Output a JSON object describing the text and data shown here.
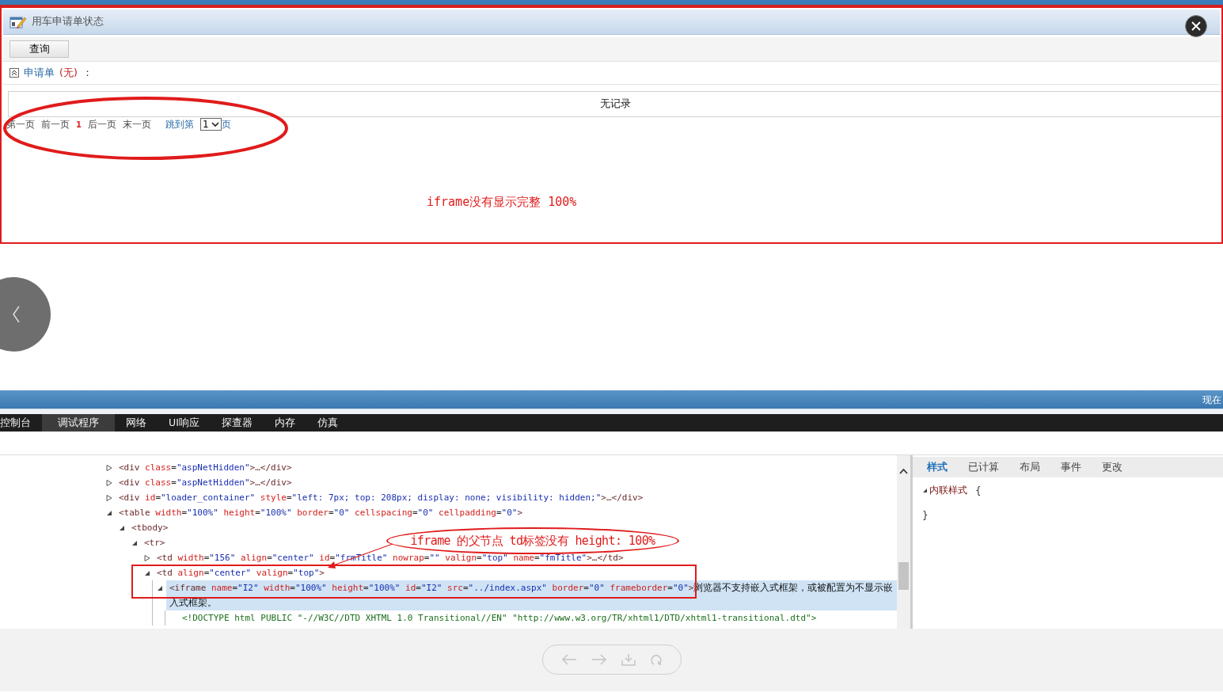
{
  "window": {
    "title": "用车申请单状态"
  },
  "toolbar": {
    "buttons": [
      "查询"
    ]
  },
  "section": {
    "label": "申请单",
    "count": "(无)",
    "colon": "：",
    "expanded": true
  },
  "table": {
    "empty_text": "无记录"
  },
  "pager": {
    "links_before": [
      "第一页",
      "前一页"
    ],
    "current": "1",
    "links_after": [
      "后一页",
      "末一页"
    ],
    "jump_prefix": "跳到第",
    "jump_value": "1",
    "jump_suffix": "页"
  },
  "annotations": [
    {
      "kind": "note",
      "text": "iframe没有显示完整 100%"
    },
    {
      "kind": "callout",
      "text": "iframe 的父节点 td标签没有 height: 100%"
    }
  ],
  "status_band": {
    "text": "现在"
  },
  "devtools": {
    "tabs": [
      {
        "label": "控制台",
        "selected": false
      },
      {
        "label": "调试程序",
        "selected": true
      },
      {
        "label": "网络",
        "selected": false
      },
      {
        "label": "UI响应",
        "selected": false
      },
      {
        "label": "探查器",
        "selected": false
      },
      {
        "label": "内存",
        "selected": false
      },
      {
        "label": "仿真",
        "selected": false
      }
    ],
    "dom_tree": [
      {
        "kind": "element",
        "expanded": false,
        "selected": false,
        "parts": [
          {
            "tag": "<div"
          },
          {
            "attr": " class"
          },
          {
            "eq": "="
          },
          {
            "val": "\"aspNetHidden\""
          },
          {
            "tag": ">…</div>"
          }
        ]
      },
      {
        "kind": "element",
        "expanded": false,
        "selected": false,
        "parts": [
          {
            "tag": "<div"
          },
          {
            "attr": " class"
          },
          {
            "eq": "="
          },
          {
            "val": "\"aspNetHidden\""
          },
          {
            "tag": ">…</div>"
          }
        ]
      },
      {
        "kind": "element",
        "expanded": false,
        "selected": false,
        "parts": [
          {
            "tag": "<div"
          },
          {
            "attr": " id"
          },
          {
            "eq": "="
          },
          {
            "val": "\"loader_container\""
          },
          {
            "attr": " style"
          },
          {
            "eq": "="
          },
          {
            "val": "\"left: 7px; top: 208px; display: none; visibility: hidden;\""
          },
          {
            "tag": ">…</div>"
          }
        ]
      },
      {
        "kind": "element",
        "expanded": true,
        "selected": false,
        "parts": [
          {
            "tag": "<table"
          },
          {
            "attr": " width"
          },
          {
            "eq": "="
          },
          {
            "val": "\"100%\""
          },
          {
            "attr": " height"
          },
          {
            "eq": "="
          },
          {
            "val": "\"100%\""
          },
          {
            "attr": " border"
          },
          {
            "eq": "="
          },
          {
            "val": "\"0\""
          },
          {
            "attr": " cellspacing"
          },
          {
            "eq": "="
          },
          {
            "val": "\"0\""
          },
          {
            "attr": " cellpadding"
          },
          {
            "eq": "="
          },
          {
            "val": "\"0\""
          },
          {
            "tag": ">"
          }
        ],
        "children": [
          {
            "kind": "element",
            "expanded": true,
            "selected": false,
            "parts": [
              {
                "tag": "<tbody>"
              }
            ],
            "children": [
              {
                "kind": "element",
                "expanded": true,
                "selected": false,
                "parts": [
                  {
                    "tag": "<tr>"
                  }
                ],
                "children": [
                  {
                    "kind": "element",
                    "expanded": false,
                    "selected": false,
                    "parts": [
                      {
                        "tag": "<td"
                      },
                      {
                        "attr": " width"
                      },
                      {
                        "eq": "="
                      },
                      {
                        "val": "\"156\""
                      },
                      {
                        "attr": " align"
                      },
                      {
                        "eq": "="
                      },
                      {
                        "val": "\"center\""
                      },
                      {
                        "attr": " id"
                      },
                      {
                        "eq": "="
                      },
                      {
                        "val": "\"frmTitle\""
                      },
                      {
                        "attr": " nowrap"
                      },
                      {
                        "eq": "="
                      },
                      {
                        "val": "\"\""
                      },
                      {
                        "attr": " valign"
                      },
                      {
                        "eq": "="
                      },
                      {
                        "val": "\"top\""
                      },
                      {
                        "attr": " name"
                      },
                      {
                        "eq": "="
                      },
                      {
                        "val": "\"fmTitle\""
                      },
                      {
                        "tag": ">…</td>"
                      }
                    ]
                  },
                  {
                    "kind": "element",
                    "expanded": true,
                    "selected": false,
                    "parts": [
                      {
                        "tag": "<td"
                      },
                      {
                        "attr": " align"
                      },
                      {
                        "eq": "="
                      },
                      {
                        "val": "\"center\""
                      },
                      {
                        "attr": " valign"
                      },
                      {
                        "eq": "="
                      },
                      {
                        "val": "\"top\""
                      },
                      {
                        "tag": ">"
                      }
                    ],
                    "children": [
                      {
                        "kind": "element",
                        "expanded": true,
                        "selected": true,
                        "parts": [
                          {
                            "tag": "<iframe"
                          },
                          {
                            "attr": " name"
                          },
                          {
                            "eq": "="
                          },
                          {
                            "val": "\"I2\""
                          },
                          {
                            "attr": " width"
                          },
                          {
                            "eq": "="
                          },
                          {
                            "val": "\"100%\""
                          },
                          {
                            "attr": " height"
                          },
                          {
                            "eq": "="
                          },
                          {
                            "val": "\"100%\""
                          },
                          {
                            "attr": " id"
                          },
                          {
                            "eq": "="
                          },
                          {
                            "val": "\"I2\""
                          },
                          {
                            "attr": " src"
                          },
                          {
                            "eq": "="
                          },
                          {
                            "val": "\"../index.aspx\""
                          },
                          {
                            "attr": " border"
                          },
                          {
                            "eq": "="
                          },
                          {
                            "val": "\"0\""
                          },
                          {
                            "attr": " frameborder"
                          },
                          {
                            "eq": "="
                          },
                          {
                            "val": "\"0\""
                          },
                          {
                            "tag": ">"
                          },
                          {
                            "text": "浏览器不支持嵌入式框架，或被配置为不显示嵌入式框架。"
                          }
                        ],
                        "children": [
                          {
                            "kind": "doctype",
                            "selected": false,
                            "parts": [
                              {
                                "doctype": "<!DOCTYPE html PUBLIC \"-//W3C//DTD XHTML 1.0 Transitional//EN\" \"http://www.w3.org/TR/xhtml1/DTD/xhtml1-transitional.dtd\">"
                              }
                            ]
                          }
                        ]
                      }
                    ]
                  }
                ]
              }
            ]
          }
        ]
      }
    ],
    "side_tabs": [
      {
        "label": "样式",
        "selected": true
      },
      {
        "label": "已计算",
        "selected": false
      },
      {
        "label": "布局",
        "selected": false
      },
      {
        "label": "事件",
        "selected": false
      },
      {
        "label": "更改",
        "selected": false
      }
    ],
    "styles": {
      "rule": "内联样式",
      "open": "{",
      "close": "}",
      "expanded": true
    }
  }
}
